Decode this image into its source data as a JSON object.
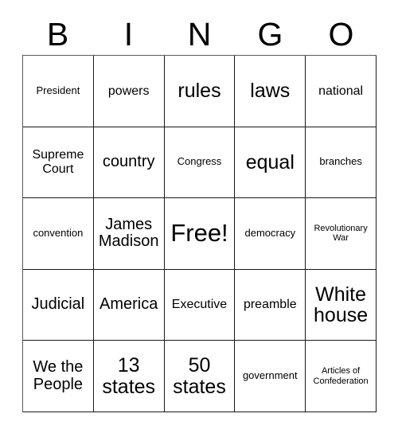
{
  "header": {
    "letters": [
      "B",
      "I",
      "N",
      "G",
      "O"
    ]
  },
  "grid": {
    "rows": 5,
    "columns": 5,
    "border_color": "#1a1a1a",
    "background_color": "#ffffff",
    "text_color": "#000000",
    "cells": [
      [
        {
          "text": "President",
          "size": "sm"
        },
        {
          "text": "powers",
          "size": "md"
        },
        {
          "text": "rules",
          "size": "xl"
        },
        {
          "text": "laws",
          "size": "xl"
        },
        {
          "text": "national",
          "size": "md"
        }
      ],
      [
        {
          "text": "Supreme Court",
          "size": "md"
        },
        {
          "text": "country",
          "size": "lg"
        },
        {
          "text": "Congress",
          "size": "sm"
        },
        {
          "text": "equal",
          "size": "xl"
        },
        {
          "text": "branches",
          "size": "sm"
        }
      ],
      [
        {
          "text": "convention",
          "size": "sm"
        },
        {
          "text": "James Madison",
          "size": "lg"
        },
        {
          "text": "Free!",
          "size": "xxl"
        },
        {
          "text": "democracy",
          "size": "sm"
        },
        {
          "text": "Revolutionary War",
          "size": "xs"
        }
      ],
      [
        {
          "text": "Judicial",
          "size": "lg"
        },
        {
          "text": "America",
          "size": "lg"
        },
        {
          "text": "Executive",
          "size": "md"
        },
        {
          "text": "preamble",
          "size": "md"
        },
        {
          "text": "White house",
          "size": "xl"
        }
      ],
      [
        {
          "text": "We the People",
          "size": "lg"
        },
        {
          "text": "13 states",
          "size": "xl"
        },
        {
          "text": "50 states",
          "size": "xl"
        },
        {
          "text": "government",
          "size": "sm"
        },
        {
          "text": "Articles of Confederation",
          "size": "xs"
        }
      ]
    ]
  }
}
